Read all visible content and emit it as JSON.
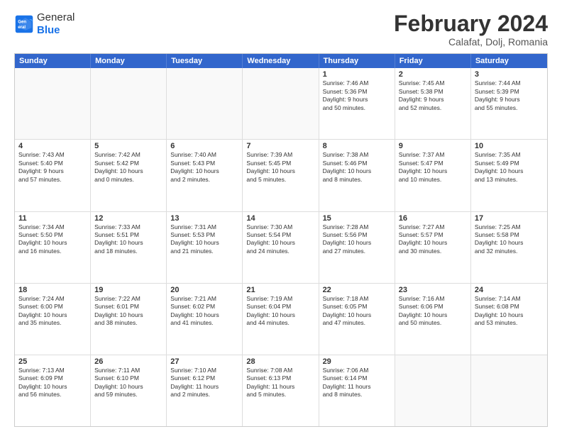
{
  "header": {
    "logo": {
      "general": "General",
      "blue": "Blue"
    },
    "title": "February 2024",
    "subtitle": "Calafat, Dolj, Romania"
  },
  "calendar": {
    "days_of_week": [
      "Sunday",
      "Monday",
      "Tuesday",
      "Wednesday",
      "Thursday",
      "Friday",
      "Saturday"
    ],
    "weeks": [
      {
        "cells": [
          {
            "day": "",
            "empty": true
          },
          {
            "day": "",
            "empty": true
          },
          {
            "day": "",
            "empty": true
          },
          {
            "day": "",
            "empty": true
          },
          {
            "day": "1",
            "lines": [
              "Sunrise: 7:46 AM",
              "Sunset: 5:36 PM",
              "Daylight: 9 hours",
              "and 50 minutes."
            ]
          },
          {
            "day": "2",
            "lines": [
              "Sunrise: 7:45 AM",
              "Sunset: 5:38 PM",
              "Daylight: 9 hours",
              "and 52 minutes."
            ]
          },
          {
            "day": "3",
            "lines": [
              "Sunrise: 7:44 AM",
              "Sunset: 5:39 PM",
              "Daylight: 9 hours",
              "and 55 minutes."
            ]
          }
        ]
      },
      {
        "cells": [
          {
            "day": "4",
            "lines": [
              "Sunrise: 7:43 AM",
              "Sunset: 5:40 PM",
              "Daylight: 9 hours",
              "and 57 minutes."
            ]
          },
          {
            "day": "5",
            "lines": [
              "Sunrise: 7:42 AM",
              "Sunset: 5:42 PM",
              "Daylight: 10 hours",
              "and 0 minutes."
            ]
          },
          {
            "day": "6",
            "lines": [
              "Sunrise: 7:40 AM",
              "Sunset: 5:43 PM",
              "Daylight: 10 hours",
              "and 2 minutes."
            ]
          },
          {
            "day": "7",
            "lines": [
              "Sunrise: 7:39 AM",
              "Sunset: 5:45 PM",
              "Daylight: 10 hours",
              "and 5 minutes."
            ]
          },
          {
            "day": "8",
            "lines": [
              "Sunrise: 7:38 AM",
              "Sunset: 5:46 PM",
              "Daylight: 10 hours",
              "and 8 minutes."
            ]
          },
          {
            "day": "9",
            "lines": [
              "Sunrise: 7:37 AM",
              "Sunset: 5:47 PM",
              "Daylight: 10 hours",
              "and 10 minutes."
            ]
          },
          {
            "day": "10",
            "lines": [
              "Sunrise: 7:35 AM",
              "Sunset: 5:49 PM",
              "Daylight: 10 hours",
              "and 13 minutes."
            ]
          }
        ]
      },
      {
        "cells": [
          {
            "day": "11",
            "lines": [
              "Sunrise: 7:34 AM",
              "Sunset: 5:50 PM",
              "Daylight: 10 hours",
              "and 16 minutes."
            ]
          },
          {
            "day": "12",
            "lines": [
              "Sunrise: 7:33 AM",
              "Sunset: 5:51 PM",
              "Daylight: 10 hours",
              "and 18 minutes."
            ]
          },
          {
            "day": "13",
            "lines": [
              "Sunrise: 7:31 AM",
              "Sunset: 5:53 PM",
              "Daylight: 10 hours",
              "and 21 minutes."
            ]
          },
          {
            "day": "14",
            "lines": [
              "Sunrise: 7:30 AM",
              "Sunset: 5:54 PM",
              "Daylight: 10 hours",
              "and 24 minutes."
            ]
          },
          {
            "day": "15",
            "lines": [
              "Sunrise: 7:28 AM",
              "Sunset: 5:56 PM",
              "Daylight: 10 hours",
              "and 27 minutes."
            ]
          },
          {
            "day": "16",
            "lines": [
              "Sunrise: 7:27 AM",
              "Sunset: 5:57 PM",
              "Daylight: 10 hours",
              "and 30 minutes."
            ]
          },
          {
            "day": "17",
            "lines": [
              "Sunrise: 7:25 AM",
              "Sunset: 5:58 PM",
              "Daylight: 10 hours",
              "and 32 minutes."
            ]
          }
        ]
      },
      {
        "cells": [
          {
            "day": "18",
            "lines": [
              "Sunrise: 7:24 AM",
              "Sunset: 6:00 PM",
              "Daylight: 10 hours",
              "and 35 minutes."
            ]
          },
          {
            "day": "19",
            "lines": [
              "Sunrise: 7:22 AM",
              "Sunset: 6:01 PM",
              "Daylight: 10 hours",
              "and 38 minutes."
            ]
          },
          {
            "day": "20",
            "lines": [
              "Sunrise: 7:21 AM",
              "Sunset: 6:02 PM",
              "Daylight: 10 hours",
              "and 41 minutes."
            ]
          },
          {
            "day": "21",
            "lines": [
              "Sunrise: 7:19 AM",
              "Sunset: 6:04 PM",
              "Daylight: 10 hours",
              "and 44 minutes."
            ]
          },
          {
            "day": "22",
            "lines": [
              "Sunrise: 7:18 AM",
              "Sunset: 6:05 PM",
              "Daylight: 10 hours",
              "and 47 minutes."
            ]
          },
          {
            "day": "23",
            "lines": [
              "Sunrise: 7:16 AM",
              "Sunset: 6:06 PM",
              "Daylight: 10 hours",
              "and 50 minutes."
            ]
          },
          {
            "day": "24",
            "lines": [
              "Sunrise: 7:14 AM",
              "Sunset: 6:08 PM",
              "Daylight: 10 hours",
              "and 53 minutes."
            ]
          }
        ]
      },
      {
        "cells": [
          {
            "day": "25",
            "lines": [
              "Sunrise: 7:13 AM",
              "Sunset: 6:09 PM",
              "Daylight: 10 hours",
              "and 56 minutes."
            ]
          },
          {
            "day": "26",
            "lines": [
              "Sunrise: 7:11 AM",
              "Sunset: 6:10 PM",
              "Daylight: 10 hours",
              "and 59 minutes."
            ]
          },
          {
            "day": "27",
            "lines": [
              "Sunrise: 7:10 AM",
              "Sunset: 6:12 PM",
              "Daylight: 11 hours",
              "and 2 minutes."
            ]
          },
          {
            "day": "28",
            "lines": [
              "Sunrise: 7:08 AM",
              "Sunset: 6:13 PM",
              "Daylight: 11 hours",
              "and 5 minutes."
            ]
          },
          {
            "day": "29",
            "lines": [
              "Sunrise: 7:06 AM",
              "Sunset: 6:14 PM",
              "Daylight: 11 hours",
              "and 8 minutes."
            ]
          },
          {
            "day": "",
            "empty": true
          },
          {
            "day": "",
            "empty": true
          }
        ]
      }
    ]
  }
}
